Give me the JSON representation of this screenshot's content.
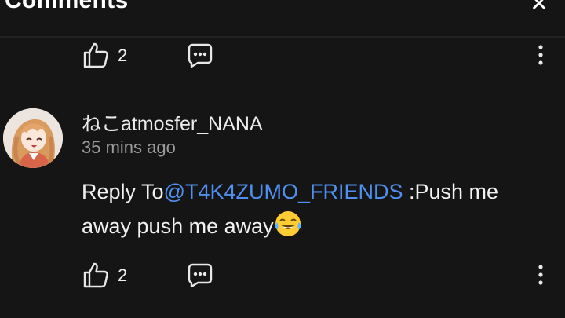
{
  "header": {
    "title": "Comments",
    "close_icon": "close-icon"
  },
  "previous_comment": {
    "like_count": "2",
    "like_icon": "thumbs-up-icon",
    "reply_icon": "comment-bubble-icon",
    "more_icon": "more-vertical-icon"
  },
  "comment": {
    "username": "ねこatmosfer_NANA",
    "timestamp": "35 mins ago",
    "reply_prefix": "Reply To",
    "mention": "@T4K4ZUMO_FRIENDS",
    "text": " :Push me away push me away",
    "emoji": "😂",
    "like_count": "2",
    "like_icon": "thumbs-up-icon",
    "reply_icon": "comment-bubble-icon",
    "more_icon": "more-vertical-icon"
  },
  "colors": {
    "background": "#151515",
    "mention": "#4f8ff0",
    "secondary_text": "#9a9a9a"
  }
}
